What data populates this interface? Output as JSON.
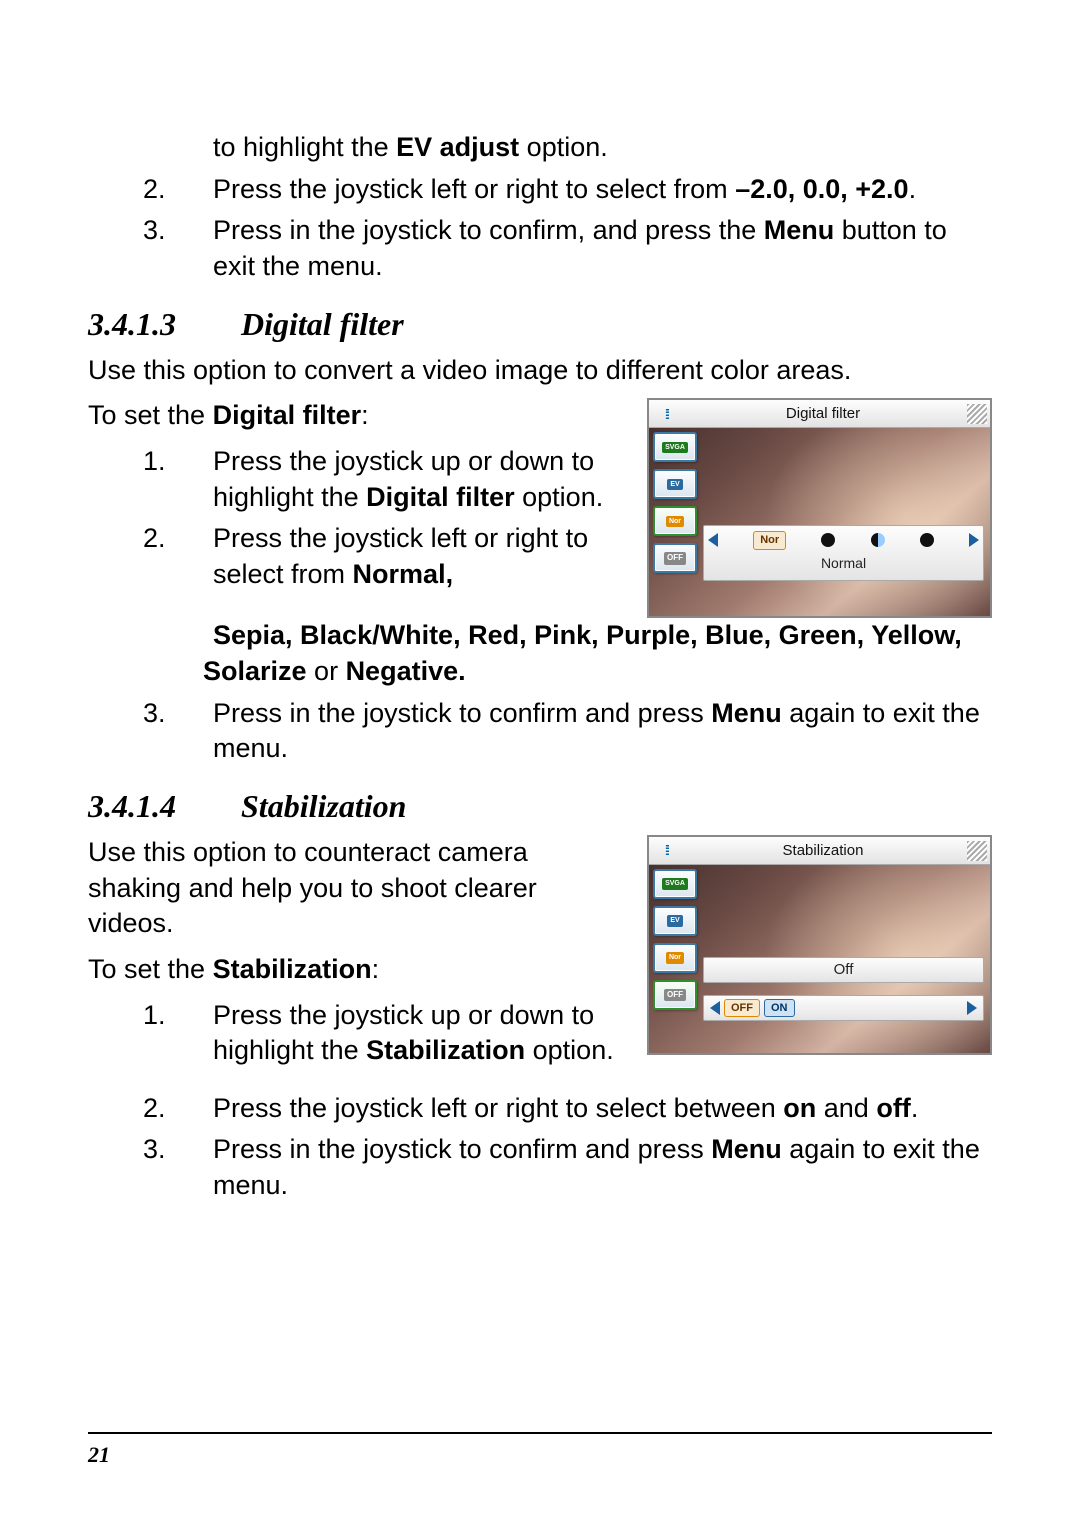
{
  "ev_section": {
    "intro": "to highlight the <b>EV adjust</b> option.",
    "step2": "Press the joystick left or right to select from <b>–2.0, 0.0, +2.0</b>.",
    "step3": "Press in the joystick to confirm, and press the <b>Menu</b> button to exit the menu."
  },
  "digital_filter": {
    "num": "3.4.1.3",
    "title": "Digital filter",
    "intro": "Use this option to convert a video image to different color areas.",
    "toset_prefix": "To set the ",
    "toset_bold": "Digital filter",
    "toset_suffix": ":",
    "step1": "Press the joystick up or down to highlight the <b>Digital filter</b> option.",
    "step2": "Press the joystick left or right to select from <b>Normal, Sepia, Black/White, Red, Pink, Purple, Blue, Green, Yellow, Solarize</b> or <b>Negative.</b>",
    "step3": "Press in the joystick to confirm and press <b>Menu</b> again to exit the menu."
  },
  "stabilization": {
    "num": "3.4.1.4",
    "title": "Stabilization",
    "intro": "Use this option to counteract camera shaking and help you to shoot clearer videos.",
    "toset_prefix": "To set the ",
    "toset_bold": "Stabilization",
    "toset_suffix": ":",
    "step1": "Press the joystick up or down to highlight the <b>Stabilization</b> option.",
    "step2": "Press the joystick left or right to select between <b>on</b> and <b>off</b>.",
    "step3": "Press in the joystick to confirm and press <b>Menu</b> again to exit the menu."
  },
  "ui_filter": {
    "title": "Digital filter",
    "side": {
      "svga": "SVGA",
      "ev": "EV",
      "nor": "Nor",
      "off": "OFF"
    },
    "opt_label": "Nor",
    "sublabel": "Normal"
  },
  "ui_stab": {
    "title": "Stabilization",
    "side": {
      "svga": "SVGA",
      "ev": "EV",
      "nor": "Nor",
      "off": "OFF"
    },
    "status": "Off",
    "opt_off": "OFF",
    "opt_on": "ON"
  },
  "page_number": "21"
}
